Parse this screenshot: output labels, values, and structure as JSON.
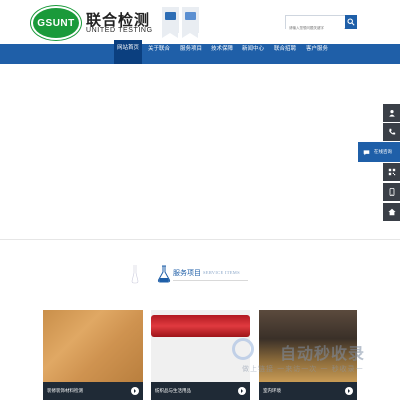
{
  "header": {
    "logo_text": "GSUNT",
    "brand_cn": "联合检测",
    "brand_en": "UNITED TESTING"
  },
  "search": {
    "placeholder": "请输入您想问题关键字"
  },
  "nav": {
    "items": [
      "网站首页",
      "关于联合",
      "服务项目",
      "技术保障",
      "新闻中心",
      "联合招聘",
      "客户服务"
    ],
    "active_index": 0
  },
  "float_bar": {
    "chat_label": "在线咨询",
    "icons": [
      "user-icon",
      "phone-icon",
      "chat-icon",
      "qr-icon",
      "mobile-icon",
      "home-icon"
    ]
  },
  "services": {
    "title": "服务项目",
    "subtitle": "SERVICE ITEMS",
    "cards": [
      {
        "caption": "装修装饰材料检测"
      },
      {
        "caption": "纺织品与生活用品"
      },
      {
        "caption": "室内环境"
      }
    ]
  },
  "watermark": {
    "title": "自动秒收录",
    "subtitle": "做上链接 一来访一次 一 秒收录一"
  },
  "colors": {
    "brand_blue": "#1f5fa8",
    "nav_active": "#0b3f7f",
    "logo_green": "#1a9a3a",
    "float_dark": "#3a3f47"
  }
}
